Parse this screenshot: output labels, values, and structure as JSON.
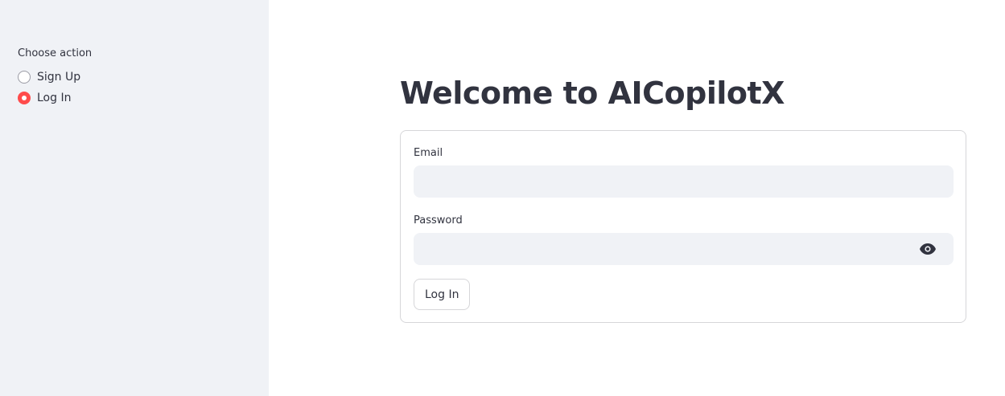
{
  "sidebar": {
    "group_label": "Choose action",
    "options": [
      {
        "label": "Sign Up",
        "selected": false
      },
      {
        "label": "Log In",
        "selected": true
      }
    ],
    "accent_color": "#ff4b4b"
  },
  "main": {
    "title": "Welcome to AICopilotX",
    "form": {
      "email_label": "Email",
      "email_value": "",
      "password_label": "Password",
      "password_value": "",
      "password_toggle_icon": "eye-icon",
      "submit_label": "Log In"
    }
  }
}
